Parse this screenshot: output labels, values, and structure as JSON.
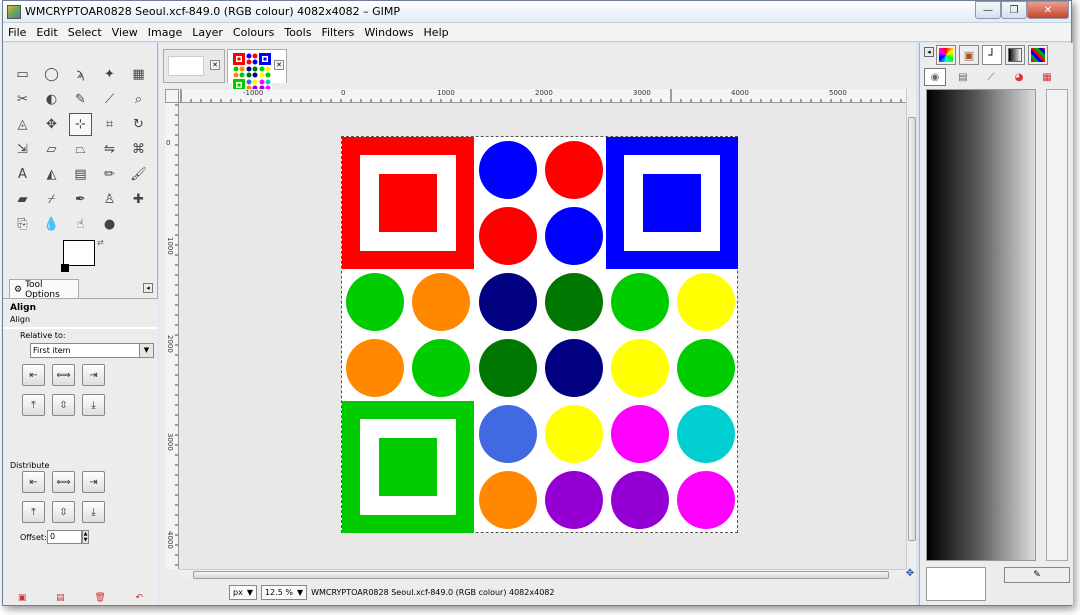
{
  "window": {
    "title": "WMCRYPTOAR0828 Seoul.xcf-849.0 (RGB colour) 4082x4082 – GIMP",
    "minimize_glyph": "—",
    "maximize_glyph": "❐",
    "close_glyph": "✕"
  },
  "menu": [
    "File",
    "Edit",
    "Select",
    "View",
    "Image",
    "Layer",
    "Colours",
    "Tools",
    "Filters",
    "Windows",
    "Help"
  ],
  "tools": [
    {
      "icon": "rect-select-icon",
      "glyph": "▭"
    },
    {
      "icon": "ellipse-select-icon",
      "glyph": "◯"
    },
    {
      "icon": "free-select-icon",
      "glyph": "ϡ"
    },
    {
      "icon": "fuzzy-select-icon",
      "glyph": "✦"
    },
    {
      "icon": "color-select-icon",
      "glyph": "▦"
    },
    {
      "icon": "scissors-icon",
      "glyph": "✂"
    },
    {
      "icon": "foreground-select-icon",
      "glyph": "◐"
    },
    {
      "icon": "paths-icon",
      "glyph": "✎"
    },
    {
      "icon": "color-picker-icon",
      "glyph": "⟋"
    },
    {
      "icon": "zoom-icon",
      "glyph": "⌕"
    },
    {
      "icon": "measure-icon",
      "glyph": "◬"
    },
    {
      "icon": "move-icon",
      "glyph": "✥"
    },
    {
      "icon": "align-icon",
      "glyph": "⊹"
    },
    {
      "icon": "crop-icon",
      "glyph": "⌗"
    },
    {
      "icon": "rotate-icon",
      "glyph": "↻"
    },
    {
      "icon": "scale-icon",
      "glyph": "⇲"
    },
    {
      "icon": "shear-icon",
      "glyph": "▱"
    },
    {
      "icon": "perspective-icon",
      "glyph": "⏢"
    },
    {
      "icon": "flip-icon",
      "glyph": "⇋"
    },
    {
      "icon": "cage-icon",
      "glyph": "⌘"
    },
    {
      "icon": "text-icon",
      "glyph": "A"
    },
    {
      "icon": "bucket-fill-icon",
      "glyph": "◭"
    },
    {
      "icon": "blend-icon",
      "glyph": "▤"
    },
    {
      "icon": "pencil-icon",
      "glyph": "✏"
    },
    {
      "icon": "paintbrush-icon",
      "glyph": "🖌"
    },
    {
      "icon": "eraser-icon",
      "glyph": "▰"
    },
    {
      "icon": "airbrush-icon",
      "glyph": "⌿"
    },
    {
      "icon": "ink-icon",
      "glyph": "✒"
    },
    {
      "icon": "clone-icon",
      "glyph": "♙"
    },
    {
      "icon": "heal-icon",
      "glyph": "✚"
    },
    {
      "icon": "perspective-clone-icon",
      "glyph": "⎘"
    },
    {
      "icon": "blur-icon",
      "glyph": "💧"
    },
    {
      "icon": "smudge-icon",
      "glyph": "☝"
    },
    {
      "icon": "dodge-burn-icon",
      "glyph": "●"
    }
  ],
  "tool_options": {
    "tab_label": "Tool Options",
    "title": "Align",
    "subtitle": "Align",
    "relative_label": "Relative to:",
    "relative_value": "First item",
    "distribute_label": "Distribute",
    "offset_label": "Offset:",
    "offset_value": "0"
  },
  "ruler_h": [
    "-1000",
    "0",
    "1000",
    "2000",
    "3000",
    "4000",
    "5000"
  ],
  "ruler_v": [
    "0",
    "1000",
    "2000",
    "3000",
    "4000"
  ],
  "status": {
    "unit": "px",
    "zoom": "12.5 %",
    "text": "WMCRYPTOAR0828 Seoul.xcf-849.0 (RGB colour) 4082x4082"
  },
  "colors": {
    "red": "#ff0000",
    "blue": "#0000ff",
    "green": "#00cc00",
    "darkgreen": "#007700",
    "navy": "#000080",
    "orange": "#ff8800",
    "yellow": "#ffff00",
    "royal": "#4169e1",
    "magenta": "#ff00ff",
    "cyan": "#00ced1",
    "purple": "#9400d3"
  }
}
